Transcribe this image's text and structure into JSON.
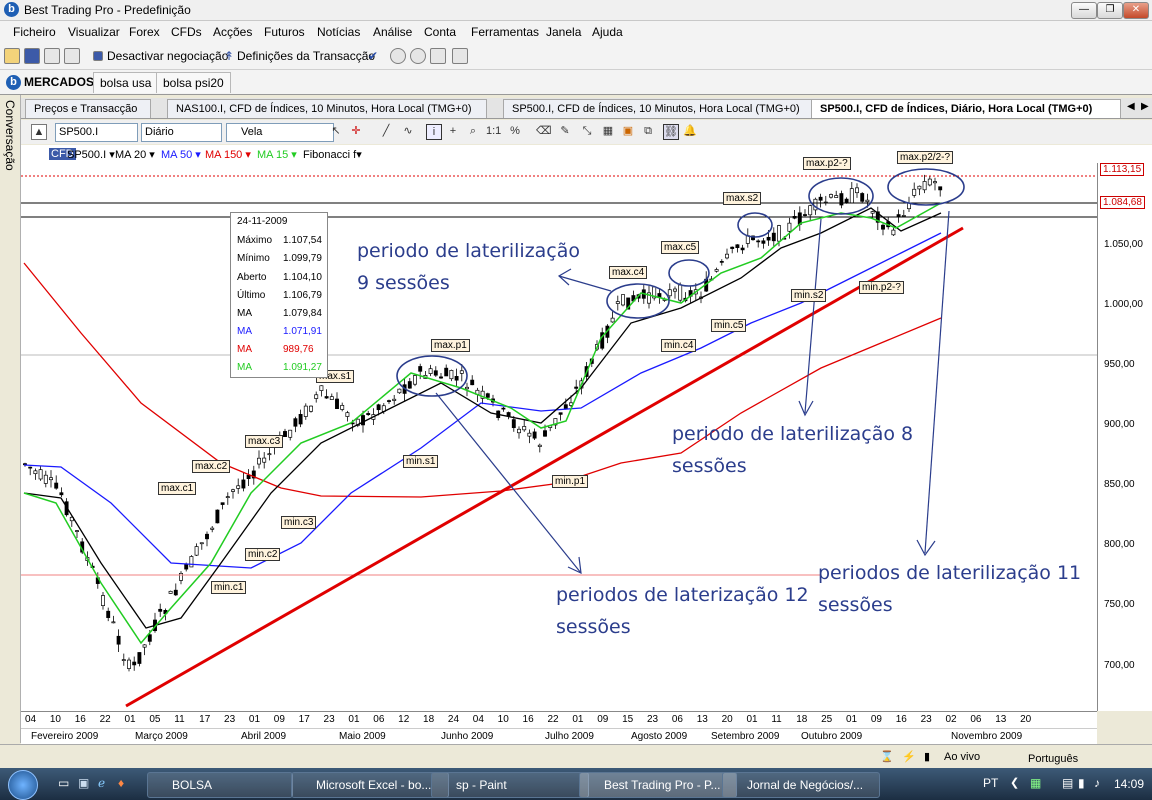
{
  "window": {
    "title": "Best Trading Pro - Predefinição",
    "minimize": "—",
    "maximize": "❐",
    "close": "✕"
  },
  "menu": [
    "Ficheiro",
    "Visualizar",
    "Forex",
    "CFDs",
    "Acções",
    "Futuros",
    "Notícias",
    "Análise",
    "Conta",
    "Ferramentas",
    "Janela",
    "Ajuda"
  ],
  "toolbar": {
    "deactivate": "Desactivar negociação",
    "settings": "Definições da Transacção"
  },
  "market_tabs": [
    "MERCADOS",
    "bolsa usa",
    "bolsa psi20"
  ],
  "side_tab": "Conversação",
  "chart_tabs": [
    "Preços e Transacção",
    "NAS100.I, CFD de Índices, 10 Minutos, Hora Local (TMG+0)",
    "SP500.I, CFD de Índices, 10 Minutos, Hora Local (TMG+0)",
    "SP500.I, CFD de Índices, Diário, Hora Local (TMG+0)"
  ],
  "chart_toolbar": {
    "symbol": "SP500.I",
    "period": "Diário",
    "style": "Vela",
    "ratio": "1:1",
    "percent": "%"
  },
  "indicators": [
    {
      "label": "SP500.I ▾",
      "color": "#000000"
    },
    {
      "label": "MA 20 ▾",
      "color": "#000000"
    },
    {
      "label": "MA 50 ▾",
      "color": "#1a1aff"
    },
    {
      "label": "MA 150 ▾",
      "color": "#e00000"
    },
    {
      "label": "MA 15 ▾",
      "color": "#22cc22"
    },
    {
      "label": "Fibonacci f▾",
      "color": "#000000"
    }
  ],
  "tooltip": {
    "date": "24-11-2009",
    "rows": [
      {
        "k": "Máximo",
        "v": "1.107,54",
        "c": "#000"
      },
      {
        "k": "Mínimo",
        "v": "1.099,79",
        "c": "#000"
      },
      {
        "k": "Aberto",
        "v": "1.104,10",
        "c": "#000"
      },
      {
        "k": "Último",
        "v": "1.106,79",
        "c": "#000"
      },
      {
        "k": "MA",
        "v": "1.079,84",
        "c": "#000"
      },
      {
        "k": "MA",
        "v": "1.071,91",
        "c": "#1a1aff"
      },
      {
        "k": "MA",
        "v": "989,76",
        "c": "#e00000"
      },
      {
        "k": "MA",
        "v": "1.091,27",
        "c": "#22cc22"
      }
    ]
  },
  "y_ticks": [
    "1.050,00",
    "1.000,00",
    "950,00",
    "900,00",
    "850,00",
    "800,00",
    "750,00",
    "700,00"
  ],
  "price_boxes": [
    "1.113,15",
    "1.084,68"
  ],
  "x_days": [
    "04",
    "10",
    "16",
    "22",
    "01",
    "05",
    "11",
    "17",
    "23",
    "01",
    "09",
    "17",
    "23",
    "01",
    "06",
    "12",
    "18",
    "24",
    "04",
    "10",
    "16",
    "22",
    "01",
    "09",
    "15",
    "23",
    "06",
    "13",
    "20",
    "01",
    "11",
    "18",
    "25",
    "01",
    "09",
    "16",
    "23",
    "02",
    "06",
    "13",
    "20"
  ],
  "x_months": [
    "Fevereiro 2009",
    "Março 2009",
    "Abril 2009",
    "Maio 2009",
    "Junho 2009",
    "Julho 2009",
    "Agosto 2009",
    "Setembro 2009",
    "Outubro 2009",
    "Novembro 2009"
  ],
  "labels": [
    "max.c1",
    "max.c2",
    "max.c3",
    "max.s1",
    "max.p1",
    "min.s1",
    "min.c3",
    "min.c2",
    "min.c1",
    "min.p1",
    "max.c4",
    "max.c5",
    "min.c4",
    "min.c5",
    "max.s2",
    "min.s2",
    "max.p2-?",
    "max.p2/2-?",
    "min.p2-?"
  ],
  "annotations": [
    "periodo de laterilização\n9 sessões",
    "periodo de laterilização 8\nsessões",
    "periodos de laterização 12\nsessões",
    "periodos de laterilização 11\nsessões"
  ],
  "status": {
    "live": "Ao vivo",
    "lang": "Português"
  },
  "taskbar": {
    "items": [
      "BOLSA",
      "Microsoft Excel - bo...",
      "sp - Paint",
      "Best Trading Pro - P...",
      "Jornal de Negócios/..."
    ],
    "lang": "PT",
    "time": "14:09"
  },
  "colors": {
    "ma20": "#000000",
    "ma50": "#1a1aff",
    "ma150": "#e00000",
    "ma15": "#22cc22",
    "trendline": "#e00000",
    "annotation": "#2b3d8c"
  }
}
